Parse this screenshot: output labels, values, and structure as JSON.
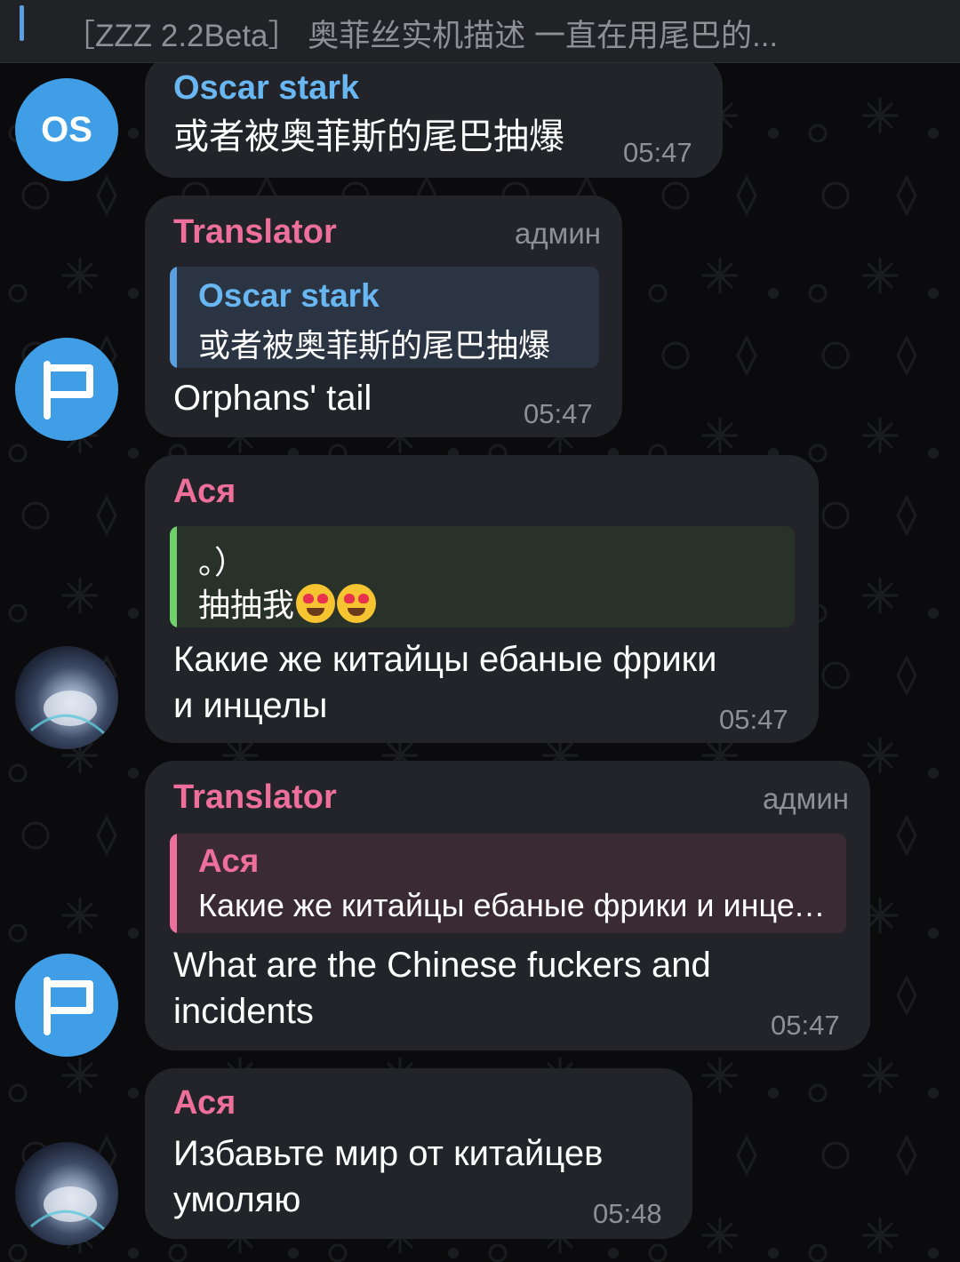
{
  "pinned": {
    "text": "［ZZZ 2.2Beta］ 奥菲丝实机描述 一直在用尾巴的..."
  },
  "colors": {
    "blue_name": "#68b7f2",
    "pink_name": "#ee6f9a",
    "green_bar": "#6fd16a"
  },
  "messages": [
    {
      "sender": "Oscar stark",
      "avatar_initials": "OS",
      "text": "或者被奥菲斯的尾巴抽爆",
      "time": "05:47"
    },
    {
      "sender": "Translator",
      "role": "админ",
      "avatar_icon": "flag-icon",
      "reply": {
        "name": "Oscar stark",
        "text": "或者被奥菲斯的尾巴抽爆"
      },
      "text": "Orphans' tail",
      "time": "05:47"
    },
    {
      "sender": "Ася",
      "avatar_icon": "anime-avatar",
      "quote": {
        "line1": "。）",
        "line2": "抽抽我",
        "emoji": "heart-eyes-emoji"
      },
      "text_line1": "Какие же китайцы ебаные фрики",
      "text_line2": "и инцелы",
      "time": "05:47"
    },
    {
      "sender": "Translator",
      "role": "админ",
      "avatar_icon": "flag-icon",
      "reply": {
        "name": "Ася",
        "text": "Какие же китайцы ебаные фрики и инцелы"
      },
      "text_line1": "What are the Chinese fuckers and",
      "text_line2": "incidents",
      "time": "05:47"
    },
    {
      "sender": "Ася",
      "avatar_icon": "anime-avatar",
      "text_line1": "Избавьте мир от китайцев",
      "text_line2": "умоляю",
      "time": "05:48"
    }
  ]
}
